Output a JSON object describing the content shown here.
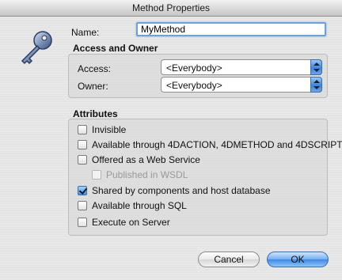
{
  "window": {
    "title": "Method Properties"
  },
  "name_field": {
    "label": "Name:",
    "value": "MyMethod"
  },
  "access_owner": {
    "title": "Access and Owner",
    "access_label": "Access:",
    "access_value": "<Everybody>",
    "owner_label": "Owner:",
    "owner_value": "<Everybody>"
  },
  "attributes": {
    "title": "Attributes",
    "items": [
      {
        "label": "Invisible",
        "checked": false,
        "enabled": true
      },
      {
        "label": "Available through 4DACTION, 4DMETHOD and 4DSCRIPT",
        "checked": false,
        "enabled": true
      },
      {
        "label": "Offered as a Web Service",
        "checked": false,
        "enabled": true
      },
      {
        "label": "Published in WSDL",
        "checked": false,
        "enabled": false
      },
      {
        "label": "Shared by components and host database",
        "checked": true,
        "enabled": true
      },
      {
        "label": "Available through SQL",
        "checked": false,
        "enabled": true
      },
      {
        "label": "Execute on Server",
        "checked": false,
        "enabled": true
      }
    ]
  },
  "buttons": {
    "cancel": "Cancel",
    "ok": "OK"
  },
  "colors": {
    "accent": "#4a8fe0",
    "default_button": "#3f88e0"
  },
  "icons": {
    "app_icon": "key-icon"
  }
}
